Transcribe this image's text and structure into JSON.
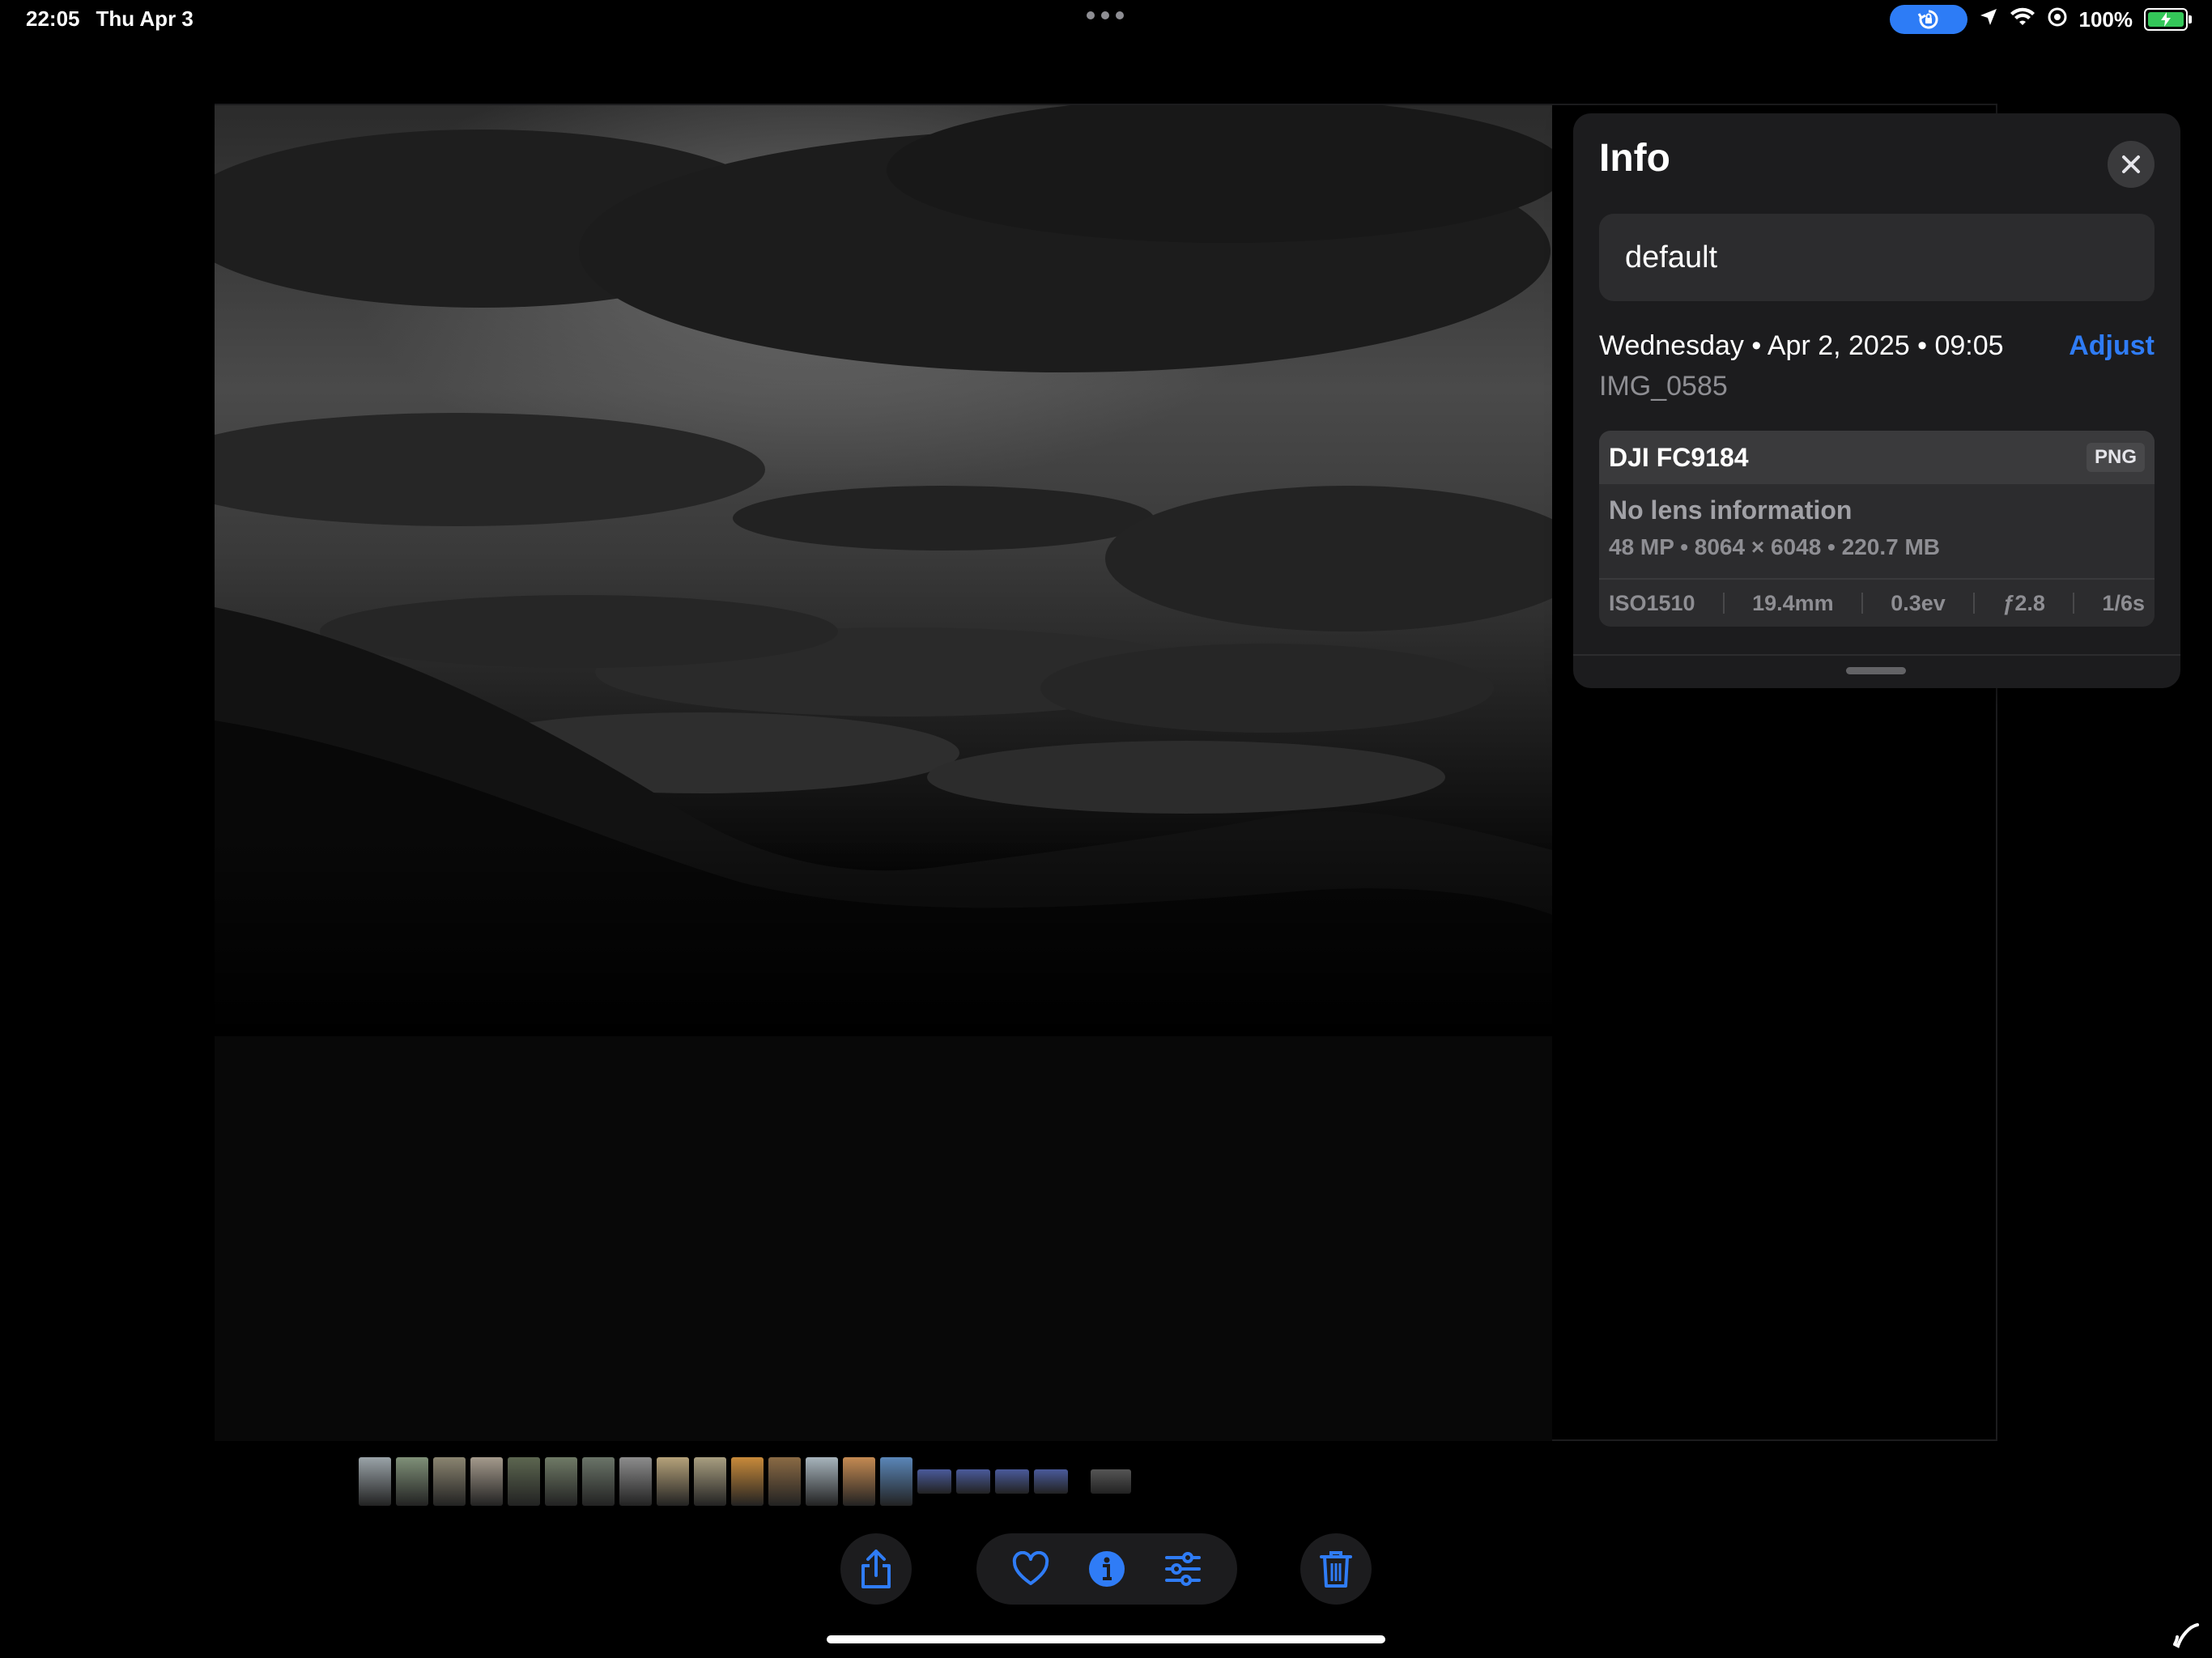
{
  "status_bar": {
    "time": "22:05",
    "date": "Thu Apr 3",
    "battery": "100%",
    "icons": [
      "rotation-lock-icon",
      "location-icon",
      "wifi-icon",
      "orientation-icon",
      "battery-icon"
    ]
  },
  "info_panel": {
    "title": "Info",
    "caption": "default",
    "datetime": "Wednesday • Apr 2, 2025 • 09:05",
    "adjust_label": "Adjust",
    "filename": "IMG_0585",
    "camera": "DJI FC9184",
    "format": "PNG",
    "lens": "No lens information",
    "specs": "48 MP • 8064 × 6048 • 220.7 MB",
    "exif": {
      "iso": "ISO1510",
      "focal_length": "19.4mm",
      "exposure_bias": "0.3ev",
      "aperture": "ƒ2.8",
      "shutter": "1/6s"
    }
  },
  "filmstrip": {
    "thumbnail_colors": [
      "#9aa3a8",
      "#7f9078",
      "#8a8470",
      "#a49a8c",
      "#5c6650",
      "#6f7a66",
      "#6a7468",
      "#8c8c8c",
      "#b5a27a",
      "#a89e80",
      "#c88a3a",
      "#8a6a44",
      "#a7b4bc",
      "#c48a52",
      "#5a86b8",
      "#4a5a9a",
      "#4a5a9a",
      "#4a5a9a",
      "#4a5a9a",
      "#555555"
    ]
  },
  "toolbar": {
    "buttons": [
      "share-icon",
      "heart-icon",
      "info-icon",
      "sliders-icon",
      "trash-icon"
    ]
  },
  "colors": {
    "accent": "#2f7cf6",
    "panel": "#1c1c1e",
    "battery": "#34c759"
  }
}
